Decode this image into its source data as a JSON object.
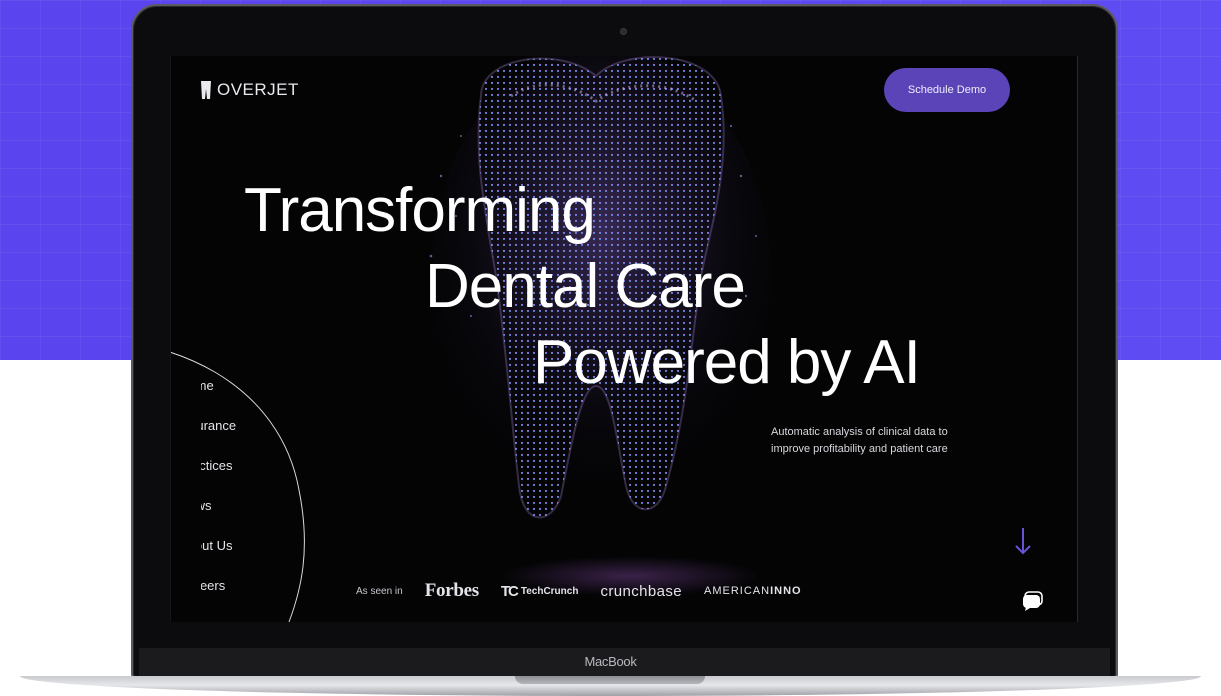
{
  "site": {
    "logo_text": "OVERJET",
    "cta_label": "Schedule Demo"
  },
  "hero": {
    "line1": "Transforming",
    "line2": "Dental Care",
    "line3": "Powered by AI",
    "subtext": "Automatic analysis of clinical data to improve profitability and patient care"
  },
  "nav": {
    "items": [
      {
        "label": "Home"
      },
      {
        "label": "Insurance"
      },
      {
        "label": "Practices"
      },
      {
        "label": "News"
      },
      {
        "label": "About Us"
      },
      {
        "label": "Careers"
      }
    ]
  },
  "press": {
    "label": "As seen in",
    "logos": {
      "forbes": "Forbes",
      "techcrunch_mark": "TC",
      "techcrunch": "TechCrunch",
      "crunchbase": "crunchbase",
      "american": "AMERICAN",
      "inno": "INNO"
    }
  },
  "device": {
    "label": "MacBook"
  },
  "icons": {
    "logo": "tooth-logo-icon",
    "scroll": "arrow-down-icon",
    "chat": "chat-bubble-icon",
    "camera": "camera-icon"
  },
  "colors": {
    "brand_purple": "#5b46f0",
    "button_purple": "#5a44b8",
    "screen_bg": "#040405"
  }
}
